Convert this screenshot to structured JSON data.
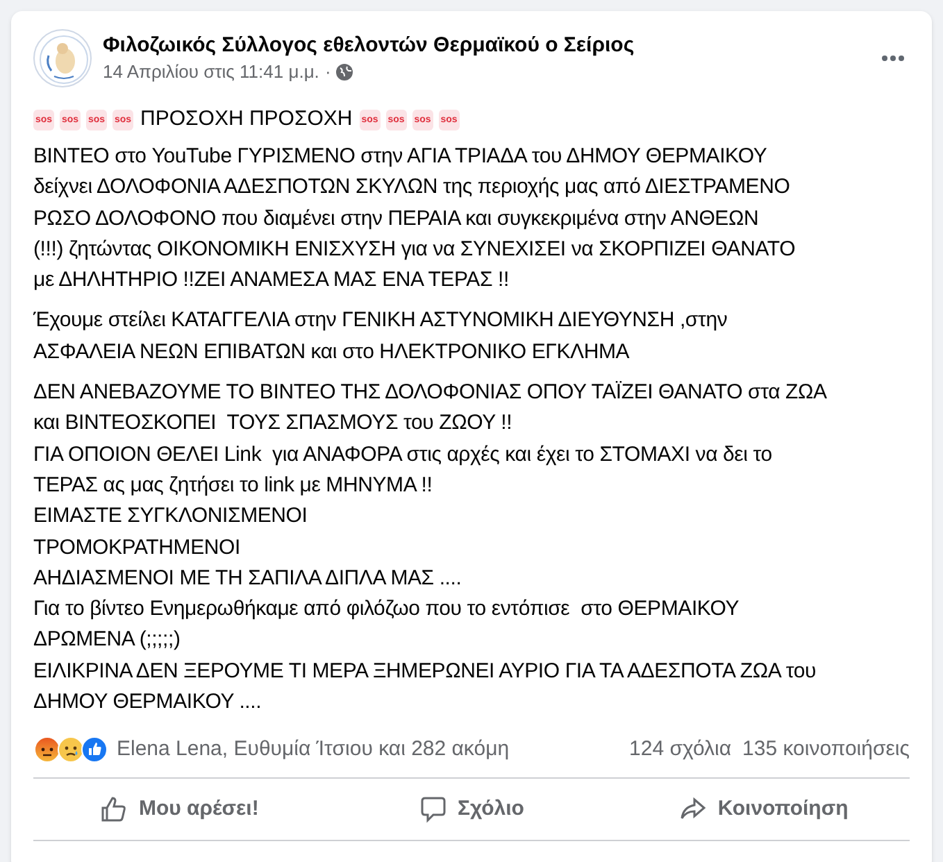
{
  "post": {
    "author": "Φιλοζωικός Σύλλογος εθελοντών Θερμαϊκού ο Σείριος",
    "timestamp": "14 Απριλίου στις 11:41 μ.μ.",
    "separator": "·"
  },
  "headline": {
    "badges_before": [
      "sos",
      "sos",
      "sos",
      "sos"
    ],
    "text": "ΠΡΟΣΟΧΗ ΠΡΟΣΟΧΗ",
    "badges_after": [
      "sos",
      "sos",
      "sos",
      "sos"
    ]
  },
  "paragraphs": [
    [
      "ΒΙΝΤΕΟ στο YouTube ΓΥΡΙΣΜΕΝΟ στην ΑΓΙΑ ΤΡΙΑΔΑ του ΔΗΜΟΥ ΘΕΡΜΑΙΚΟΥ",
      "δείχνει ΔΟΛΟΦΟΝΙΑ ΑΔΕΣΠΟΤΩΝ ΣΚΥΛΩΝ της περιοχής μας από ΔΙΕΣΤΡΑΜΕΝΟ",
      "ΡΩΣΟ ΔΟΛΟΦΟΝΟ που διαμένει στην ΠΕΡΑΙΑ και συγκεκριμένα στην ΑΝΘΕΩΝ",
      "(!!!) ζητώντας ΟΙΚΟΝΟΜΙΚΗ ΕΝΙΣΧΥΣΗ για να ΣΥΝΕΧΙΣΕΙ να ΣΚΟΡΠΙΖΕΙ ΘΑΝΑΤΟ",
      "με ΔΗΛΗΤΗΡΙΟ !!ΖΕΙ ΑΝΑΜΕΣΑ ΜΑΣ ΕΝΑ ΤΕΡΑΣ !!"
    ],
    [
      "Έχουμε στείλει ΚΑΤΑΓΓΕΛΙΑ στην ΓΕΝΙΚΗ ΑΣΤΥΝΟΜΙΚΗ ΔΙΕΥΘΥΝΣΗ ,στην",
      "ΑΣΦΑΛΕΙΑ ΝΕΩΝ ΕΠΙΒΑΤΩΝ και στο ΗΛΕΚΤΡΟΝΙΚΟ ΕΓΚΛΗΜΑ"
    ],
    [
      "ΔΕΝ ΑΝΕΒΑΖΟΥΜΕ ΤΟ ΒΙΝΤΕΟ ΤΗΣ ΔΟΛΟΦΟΝΙΑΣ ΟΠΟΥ ΤΑΪΖΕΙ ΘΑΝΑΤΟ στα ΖΩΑ",
      "και ΒΙΝΤΕΟΣΚΟΠΕΙ  ΤΟΥΣ ΣΠΑΣΜΟΥΣ του ΖΩΟΥ !!",
      "ΓΙΑ ΟΠΟΙΟΝ ΘΕΛΕΙ Link  για ΑΝΑΦΟΡΑ στις αρχές και έχει το ΣΤΟΜΑΧΙ να δει το",
      "ΤΕΡΑΣ ας μας ζητήσει το link με ΜΗΝΥΜΑ !!",
      "ΕΙΜΑΣΤΕ ΣΥΓΚΛΟΝΙΣΜΕΝΟΙ",
      "ΤΡΟΜΟΚΡΑΤΗΜΕΝΟΙ",
      "ΑΗΔΙΑΣΜΕΝΟΙ ΜΕ ΤΗ ΣΑΠΙΛΑ ΔΙΠΛΑ ΜΑΣ ....",
      "Για το βίντεο Ενημερωθήκαμε από φιλόζωο που το εντόπισε  στο ΘΕΡΜΑΙΚΟΥ",
      "ΔΡΩΜΕΝΑ (;;;;;)",
      "ΕΙΛΙΚΡΙΝΑ ΔΕΝ ΞΕΡΟΥΜΕ ΤΙ ΜΕΡΑ ΞΗΜΕΡΩΝΕΙ ΑΥΡΙΟ ΓΙΑ ΤΑ ΑΔΕΣΠΟΤΑ ΖΩΑ του",
      "ΔΗΜΟΥ ΘΕΡΜΑΙΚΟΥ ...."
    ]
  ],
  "reactions": {
    "icons": [
      {
        "kind": "angry"
      },
      {
        "kind": "sad"
      },
      {
        "kind": "like"
      }
    ],
    "names": "Elena Lena, Ευθυμία Ίτσιου και 282 ακόμη",
    "comments": "124 σχόλια",
    "shares": "135 κοινοποιήσεις"
  },
  "actions": [
    {
      "kind": "like",
      "label": "Μου αρέσει!"
    },
    {
      "kind": "comment",
      "label": "Σχόλιο"
    },
    {
      "kind": "share",
      "label": "Κοινοποίηση"
    }
  ]
}
